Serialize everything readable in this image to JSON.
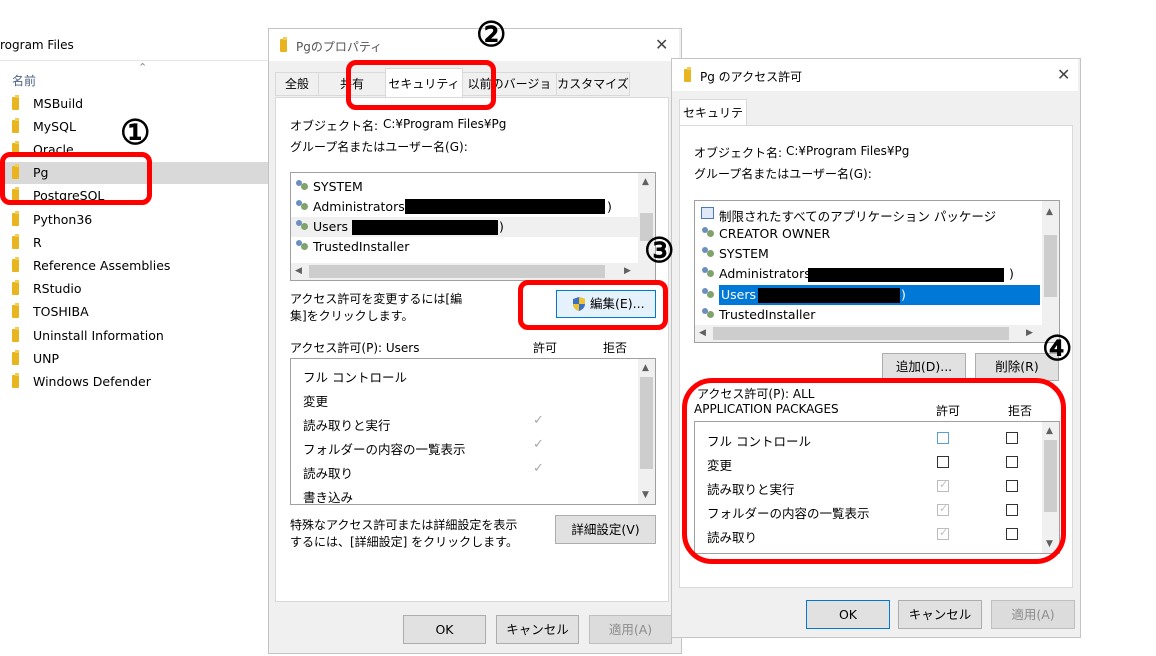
{
  "explorer": {
    "path": "rogram Files",
    "column_header": "名前",
    "items": [
      "MSBuild",
      "MySQL",
      "Oracle",
      "Pg",
      "PostgreSQL",
      "Python36",
      "R",
      "Reference Assemblies",
      "RStudio",
      "TOSHIBA",
      "Uninstall Information",
      "UNP",
      "Windows Defender"
    ]
  },
  "props": {
    "title": "Pgのプロパティ",
    "tabs": [
      "全般",
      "共有",
      "セキュリティ",
      "以前のバージョン",
      "カスタマイズ"
    ],
    "object_label": "オブジェクト名:",
    "object_value": "C:¥Program Files¥Pg",
    "group_label": "グループ名またはユーザー名(G):",
    "users": [
      "SYSTEM",
      "Administrators (",
      ")",
      "Users (",
      ")",
      "TrustedInstaller"
    ],
    "edit_note": "アクセス許可を変更するには[編集]をクリックします。",
    "edit_button": "編集(E)...",
    "perm_label": "アクセス許可(P): Users",
    "allow": "許可",
    "deny": "拒否",
    "perms": [
      "フル コントロール",
      "変更",
      "読み取りと実行",
      "フォルダーの内容の一覧表示",
      "読み取り",
      "書き込み"
    ],
    "advanced_note": "特殊なアクセス許可または詳細設定を表示するには、[詳細設定] をクリックします。",
    "advanced_button": "詳細設定(V)",
    "ok": "OK",
    "cancel": "キャンセル",
    "apply": "適用(A)",
    "check": "✓"
  },
  "perm_dialog": {
    "title": "Pg のアクセス許可",
    "tab": "セキュリティ",
    "object_label": "オブジェクト名:",
    "object_value": "C:¥Program Files¥Pg",
    "group_label": "グループ名またはユーザー名(G):",
    "users": [
      "制限されたすべてのアプリケーション パッケージ",
      "CREATOR OWNER",
      "SYSTEM",
      "Administrators (",
      ")",
      "Users (",
      ")",
      "TrustedInstaller"
    ],
    "add_button": "追加(D)...",
    "remove_button": "削除(R)",
    "perm_label_1": "アクセス許可(P): ALL",
    "perm_label_2": "APPLICATION PACKAGES",
    "allow": "許可",
    "deny": "拒否",
    "perms": [
      "フル コントロール",
      "変更",
      "読み取りと実行",
      "フォルダーの内容の一覧表示",
      "読み取り"
    ],
    "ok": "OK",
    "cancel": "キャンセル",
    "apply": "適用(A)",
    "check": "✓"
  },
  "annotations": [
    "①",
    "②",
    "③",
    "④"
  ],
  "glyphs": {
    "close": "✕",
    "up": "▲",
    "down": "▼",
    "left": "◀",
    "right": "▶",
    "sort": "⌃"
  },
  "colors": {
    "highlight": "#ff0000",
    "selection": "#0078d7",
    "folder": "#e8b520"
  }
}
